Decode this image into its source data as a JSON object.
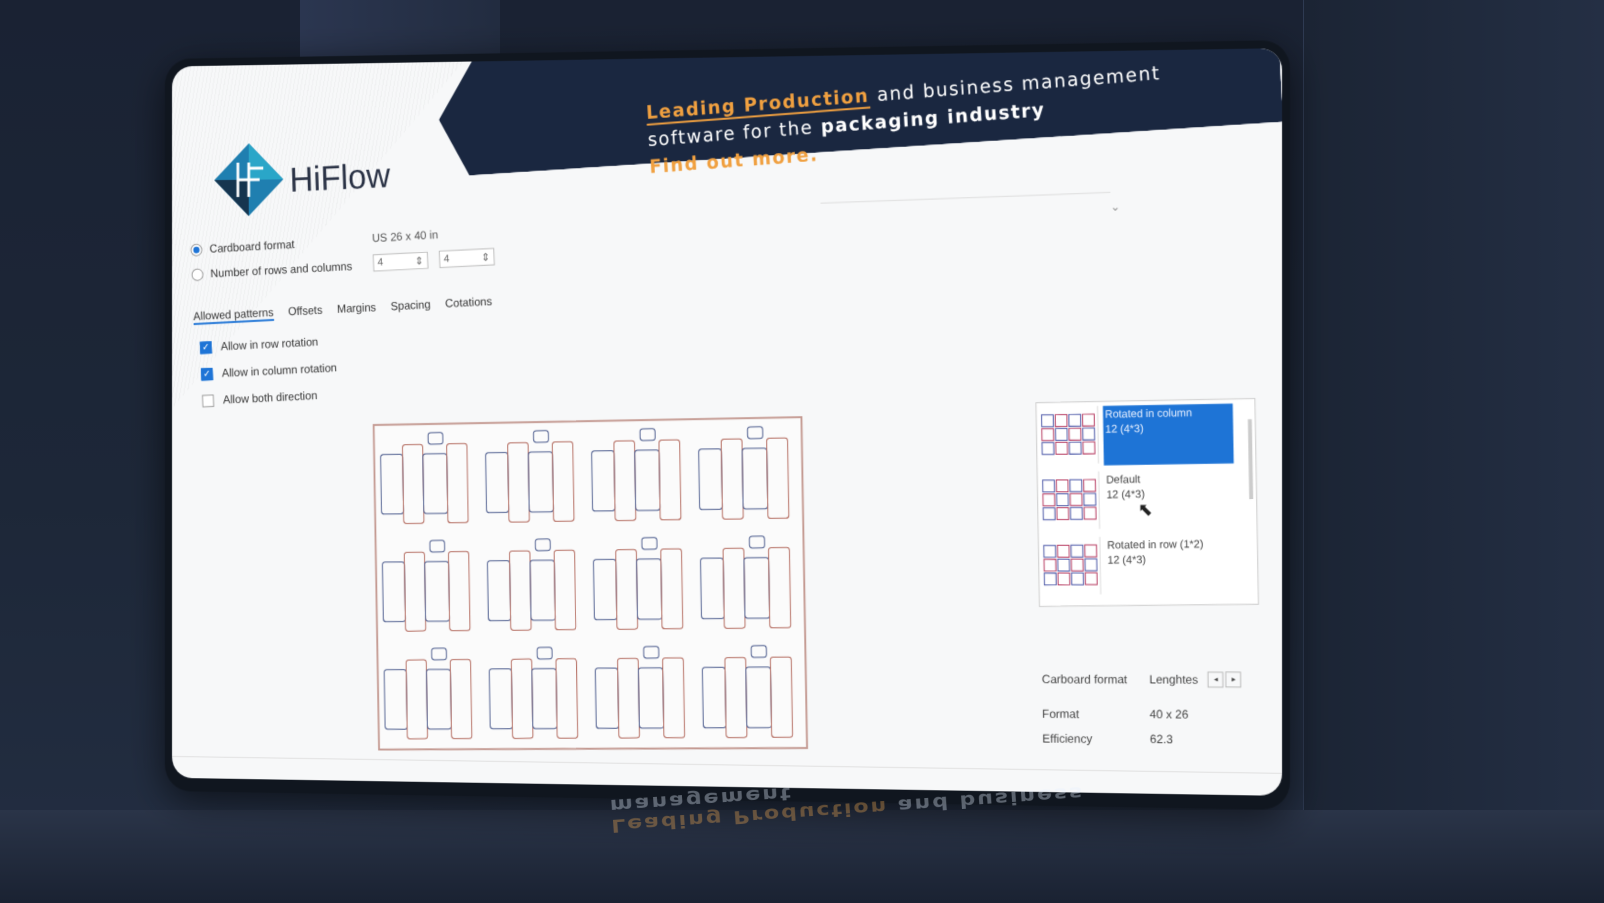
{
  "banner": {
    "highlight": "Leading Production",
    "line1_rest": "and business management",
    "line2_a": "software for the",
    "line2_b": "packaging industry",
    "line3": "Find out more."
  },
  "logo": {
    "text": "HiFlow"
  },
  "format_options": {
    "radio_cardboard": "Cardboard format",
    "radio_rows_cols": "Number of rows and columns",
    "size": "US 26 x 40 in",
    "rows_value": "4",
    "cols_value": "4"
  },
  "tabs": [
    "Allowed patterns",
    "Offsets",
    "Margins",
    "Spacing",
    "Cotations"
  ],
  "checks": [
    {
      "label": "Allow in row rotation",
      "checked": true
    },
    {
      "label": "Allow in column rotation",
      "checked": true
    },
    {
      "label": "Allow both direction",
      "checked": false
    }
  ],
  "patterns": [
    {
      "name": "Rotated in column",
      "count": "12 (4*3)",
      "selected": true
    },
    {
      "name": "Default",
      "count": "12 (4*3)",
      "selected": false
    },
    {
      "name": "Rotated in row (1*2)",
      "count": "12 (4*3)",
      "selected": false
    }
  ],
  "info": {
    "cardboard_label": "Carboard format",
    "lengths_label": "Lenghtes",
    "format_label": "Format",
    "format_value": "40 x 26",
    "efficiency_label": "Efficiency",
    "efficiency_value": "62.3"
  },
  "colors": {
    "accent": "#1e74d6",
    "banner": "#1a2740",
    "orange": "#f0a040"
  }
}
